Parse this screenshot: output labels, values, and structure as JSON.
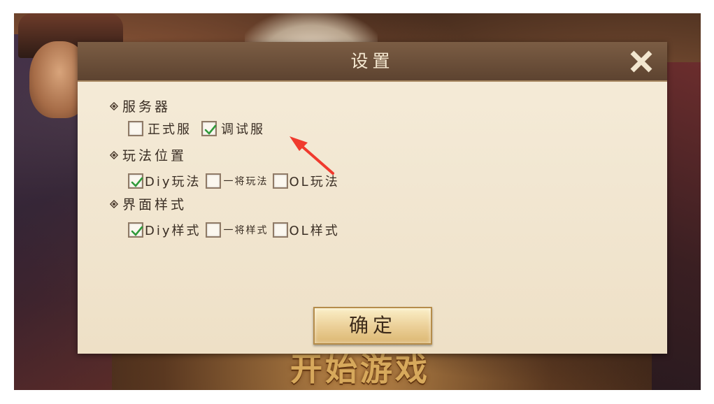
{
  "background": {
    "start_game_text": "开始游戏"
  },
  "dialog": {
    "title": "设置",
    "close_icon": "close-icon",
    "confirm_label": "确定"
  },
  "sections": [
    {
      "title": "服务器",
      "options": [
        {
          "label": "正式服",
          "checked": false
        },
        {
          "label": "调试服",
          "checked": true
        }
      ]
    },
    {
      "title": "玩法位置",
      "options": [
        {
          "label": "Diy玩法",
          "checked": true
        },
        {
          "label": "一将玩法",
          "checked": false
        },
        {
          "label": "OL玩法",
          "checked": false
        }
      ]
    },
    {
      "title": "界面样式",
      "options": [
        {
          "label": "Diy样式",
          "checked": true
        },
        {
          "label": "一将样式",
          "checked": false
        },
        {
          "label": "OL样式",
          "checked": false
        }
      ]
    }
  ],
  "colors": {
    "header_bg": "#6b4f3a",
    "dialog_bg": "#f3e8d3",
    "check_green": "#2f9a3a",
    "annotation_arrow": "#f03a2e"
  }
}
